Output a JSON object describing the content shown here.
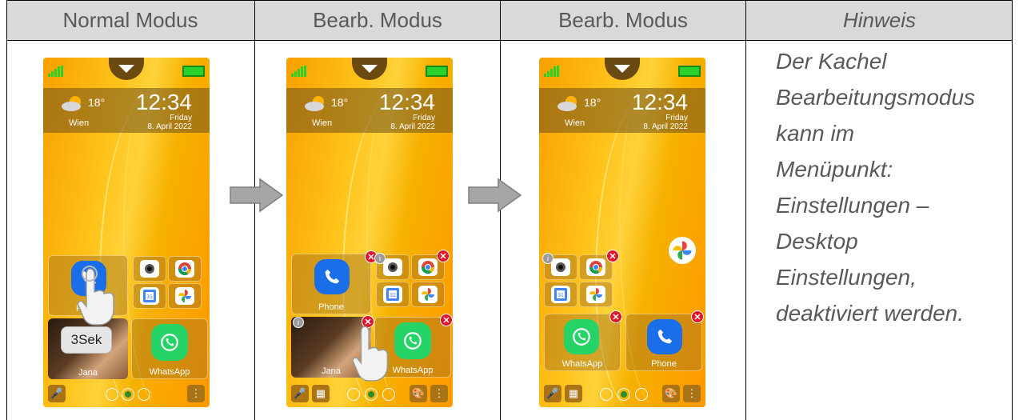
{
  "headers": [
    "Normal Modus",
    "Bearb. Modus",
    "Bearb. Modus",
    "Hinweis"
  ],
  "note_lines": [
    "Der Kachel",
    "Bearbeitungsmodus",
    "kann im",
    "Menüpunkt:",
    "Einstellungen –",
    "Desktop",
    "Einstellungen,",
    "deaktiviert werden."
  ],
  "phone": {
    "temperature": "18°",
    "city": "Wien",
    "time": "12:34",
    "weekday": "Friday",
    "date": "8. April 2022",
    "tile_phone": "Phone",
    "tile_phone_clipped": "Pho",
    "tile_contact": "Jana",
    "tile_whatsapp": "WhatsApp",
    "tile_whatsapp_clipped": "WhatsApp",
    "calendar_day": "31",
    "hold_label": "3Sek"
  },
  "colors": {
    "header_bg": "#d9d9d9",
    "wallpaper": "#ffc31a",
    "delete_badge": "#e0172b"
  }
}
